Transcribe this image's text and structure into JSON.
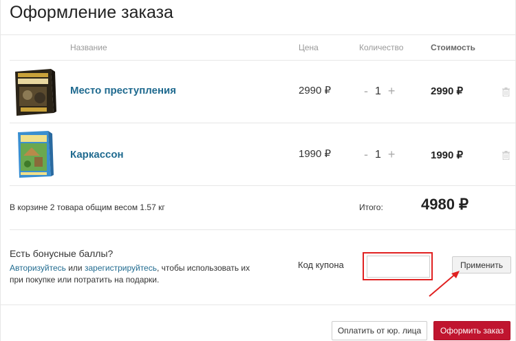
{
  "page": {
    "title": "Оформление заказа"
  },
  "table": {
    "headers": {
      "name": "Название",
      "price": "Цена",
      "quantity": "Количество",
      "cost": "Стоимость"
    },
    "rows": [
      {
        "name": "Место преступления",
        "price": "2990 ₽",
        "minus": "-",
        "quantity": "1",
        "plus": "+",
        "cost": "2990 ₽"
      },
      {
        "name": "Каркассон",
        "price": "1990 ₽",
        "minus": "-",
        "quantity": "1",
        "plus": "+",
        "cost": "1990 ₽"
      }
    ]
  },
  "summary": {
    "cart_text": "В корзине 2 товара общим весом 1.57 кг",
    "total_label": "Итого:",
    "total_value": "4980 ₽"
  },
  "bonus": {
    "question": "Есть бонусные баллы?",
    "login_link": "Авторизуйтесь",
    "or": " или ",
    "register_link": "зарегистрируйтесь",
    "rest": ", чтобы использовать их при покупке или потратить на подарки."
  },
  "coupon": {
    "label": "Код купона",
    "value": "",
    "apply_label": "Применить"
  },
  "actions": {
    "legal_label": "Оплатить от юр. лица",
    "order_label": "Оформить заказ"
  },
  "colors": {
    "link": "#1f6a8f",
    "accent": "#c0152f",
    "highlight": "#e02020"
  }
}
